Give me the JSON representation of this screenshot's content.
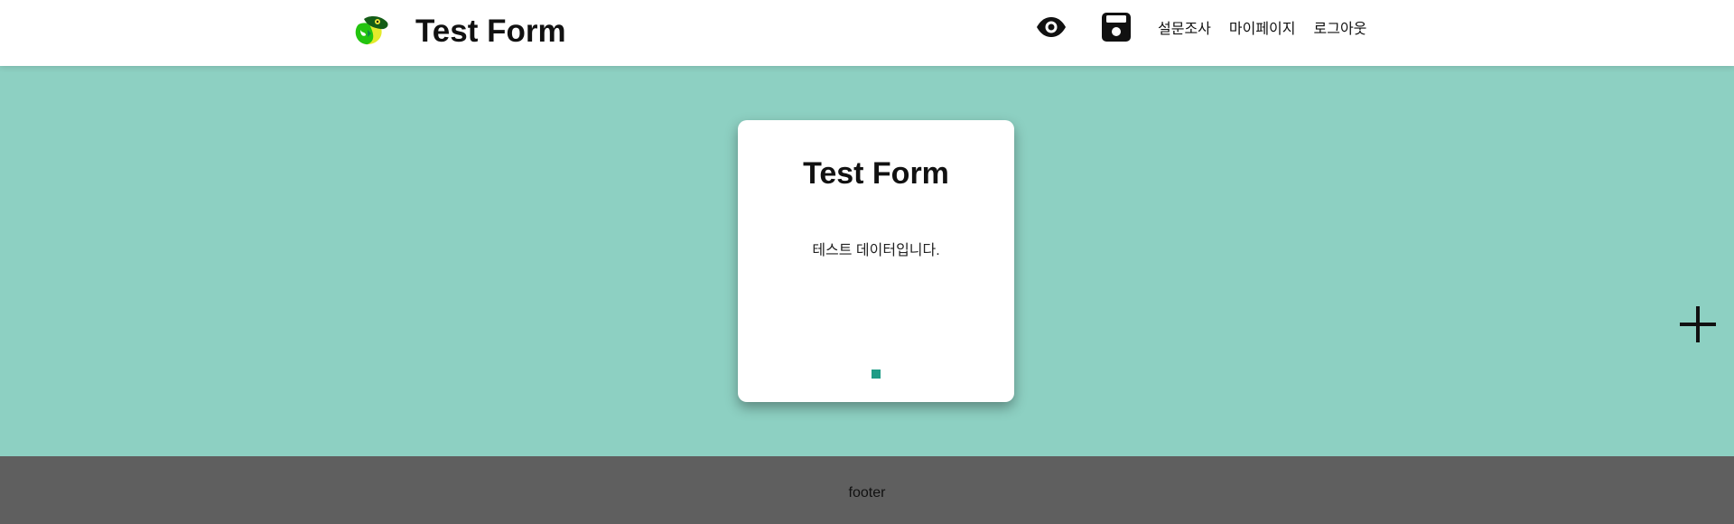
{
  "header": {
    "logo_icon": "parrot-logo-icon",
    "title": "Test Form",
    "icons": {
      "preview": "eye-icon",
      "save": "floppy-disk-icon"
    },
    "nav": [
      {
        "label": "설문조사"
      },
      {
        "label": "마이페이지"
      },
      {
        "label": "로그아웃"
      }
    ]
  },
  "main": {
    "card": {
      "title": "Test Form",
      "description": "테스트 데이터입니다.",
      "pagination_dots": 1,
      "active_dot": 1
    },
    "add_icon": "plus-icon"
  },
  "footer": {
    "text": "footer"
  },
  "colors": {
    "background": "#8dd0c2",
    "header": "#ffffff",
    "card": "#ffffff",
    "accent_dot": "#1e9c86",
    "footer": "#5f5f5f"
  }
}
